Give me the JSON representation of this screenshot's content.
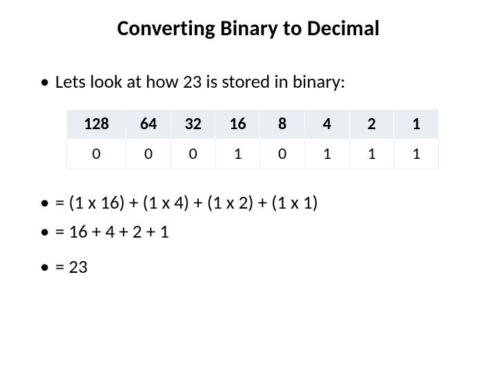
{
  "title": "Converting Binary to Decimal",
  "intro": "Lets look at how 23 is stored in binary:",
  "table": {
    "headers": [
      "128",
      "64",
      "32",
      "16",
      "8",
      "4",
      "2",
      "1"
    ],
    "bits": [
      "0",
      "0",
      "0",
      "1",
      "0",
      "1",
      "1",
      "1"
    ]
  },
  "equations": {
    "line1": "= (1 x 16) + (1 x 4) + (1 x 2) + (1 x 1)",
    "line2": "= 16 + 4 + 2 + 1",
    "line3": "= 23"
  }
}
